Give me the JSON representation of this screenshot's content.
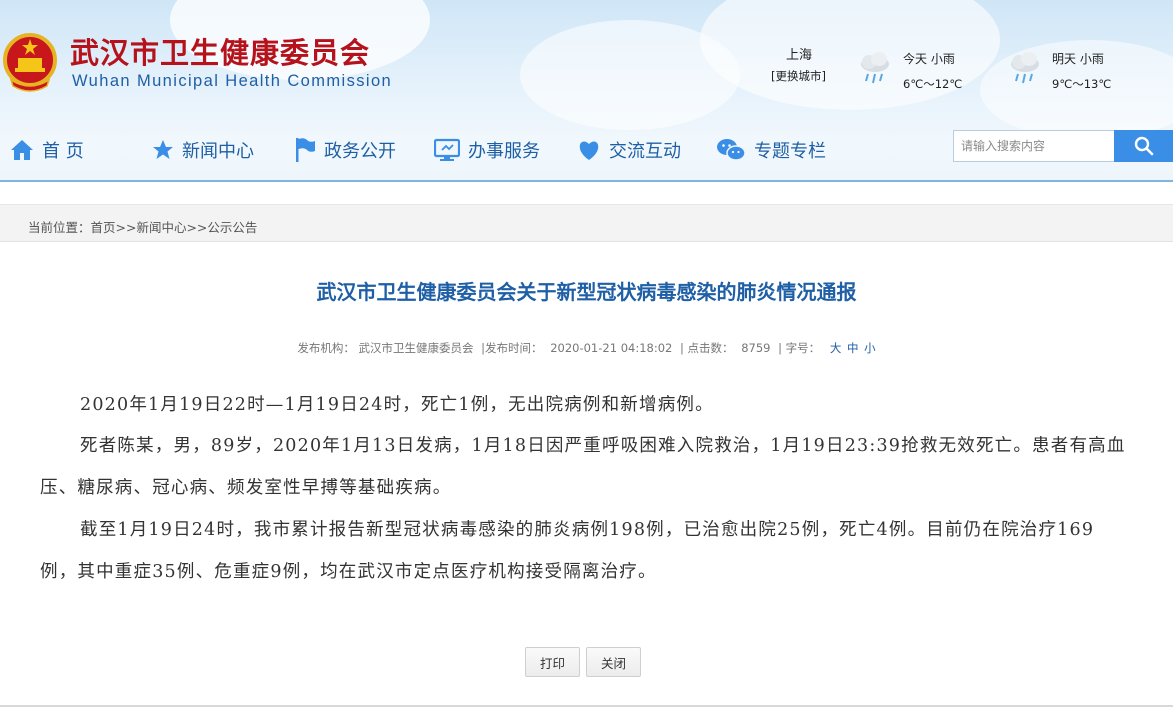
{
  "header": {
    "site_title": "武汉市卫生健康委员会",
    "site_subtitle": "Wuhan Municipal Health Commission",
    "brand_red": "#b5121b",
    "brand_blue": "#1f5fa6"
  },
  "weather": {
    "city": "上海",
    "change_city": "[更换城市]",
    "today": {
      "label": "今天  小雨",
      "temp": "6℃～12℃",
      "icon": "rain-cloud-icon"
    },
    "tomorrow": {
      "label": "明天  小雨",
      "temp": "9℃～13℃",
      "icon": "rain-cloud-icon"
    }
  },
  "nav": {
    "items": [
      {
        "label": "首  页",
        "icon": "home-icon"
      },
      {
        "label": "新闻中心",
        "icon": "star-icon"
      },
      {
        "label": "政务公开",
        "icon": "flag-icon"
      },
      {
        "label": "办事服务",
        "icon": "monitor-icon"
      },
      {
        "label": "交流互动",
        "icon": "heart-icon"
      },
      {
        "label": "专题专栏",
        "icon": "wechat-icon"
      }
    ]
  },
  "search": {
    "placeholder": "请输入搜索内容",
    "accent": "#3a8ee6"
  },
  "breadcrumb": "当前位置：首页>>新闻中心>>公示公告",
  "article": {
    "title": "武汉市卫生健康委员会关于新型冠状病毒感染的肺炎情况通报",
    "meta": {
      "publisher_label": "发布机构：",
      "publisher": "武汉市卫生健康委员会",
      "time_label": "|发布时间：",
      "time": "2020-01-21 04:18:02",
      "hits_label": "|  点击数：",
      "hits": "8759",
      "fontsize_label": "|  字号：",
      "size_large": "大",
      "size_medium": "中",
      "size_small": "小"
    },
    "paragraphs": [
      "2020年1月19日22时—1月19日24时，死亡1例，无出院病例和新增病例。",
      "死者陈某，男，89岁，2020年1月13日发病，1月18日因严重呼吸困难入院救治，1月19日23:39抢救无效死亡。患者有高血压、糖尿病、冠心病、频发室性早搏等基础疾病。",
      "截至1月19日24时，我市累计报告新型冠状病毒感染的肺炎病例198例，已治愈出院25例，死亡4例。目前仍在院治疗169例，其中重症35例、危重症9例，均在武汉市定点医疗机构接受隔离治疗。"
    ]
  },
  "buttons": {
    "print": "打印",
    "close": "关闭"
  }
}
